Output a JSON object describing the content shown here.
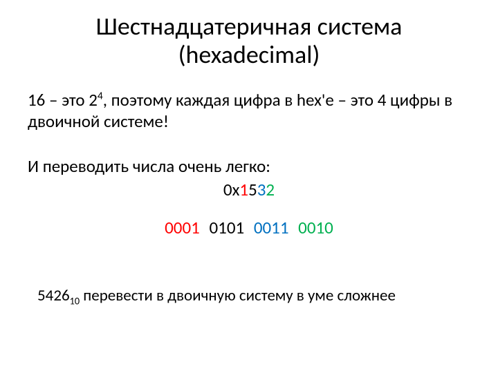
{
  "title": "Шестнадцатеричная система (hexadecimal)",
  "para1_a": "16 – это 2",
  "para1_exp": "4",
  "para1_b": ", поэтому каждая цифра в hex'е – это 4 цифры в двоичной системе!",
  "para2": "И переводить числа очень легко:",
  "hex_prefix": "0x",
  "hex_d1": "1",
  "hex_d2": "5",
  "hex_d3": "3",
  "hex_d4": "2",
  "bin_g1": "0001",
  "bin_g2": "0101",
  "bin_g3": "0011",
  "bin_g4": "0010",
  "footer_num": "5426",
  "footer_sub": "10",
  "footer_rest": " перевести в двоичную систему в уме сложнее",
  "colors": {
    "red": "#ff0000",
    "black": "#000000",
    "blue": "#0070c0",
    "green": "#00b050"
  }
}
